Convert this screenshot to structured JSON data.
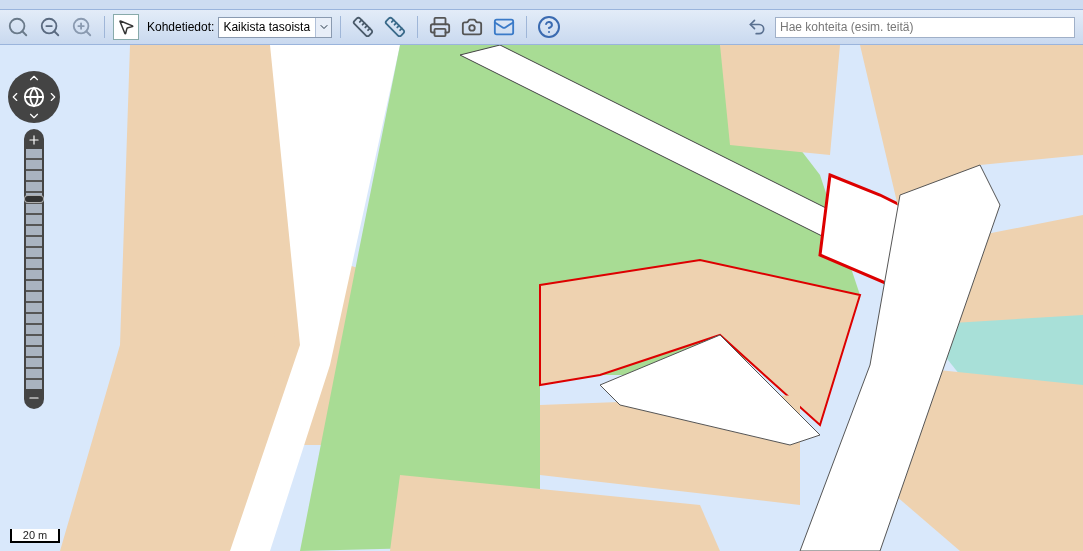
{
  "toolbar": {
    "info_label": "Kohdetiedot:",
    "layer_select": {
      "value": "Kaikista tasoista"
    },
    "search": {
      "placeholder": "Hae kohteita (esim. teitä)"
    }
  },
  "map": {
    "zoom_slider": {
      "level": 0.8
    },
    "scale_bar": "20 m"
  }
}
